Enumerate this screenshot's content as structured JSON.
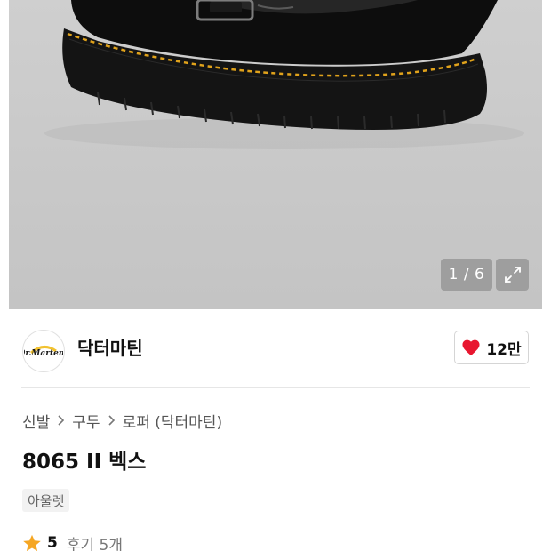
{
  "gallery": {
    "counter": "1 / 6"
  },
  "brand": {
    "name": "닥터마틴",
    "logo_text": "Dr.Martens",
    "likes": "12만"
  },
  "product": {
    "breadcrumb": [
      "신발",
      "구두",
      "로퍼 (닥터마틴)"
    ],
    "title": "8065 II 벡스",
    "tag": "아울렛",
    "rating": "5",
    "reviews": "후기 5개"
  },
  "colors": {
    "heart": "#e8162f",
    "star": "#f5a623",
    "stitch": "#e0a21b"
  }
}
